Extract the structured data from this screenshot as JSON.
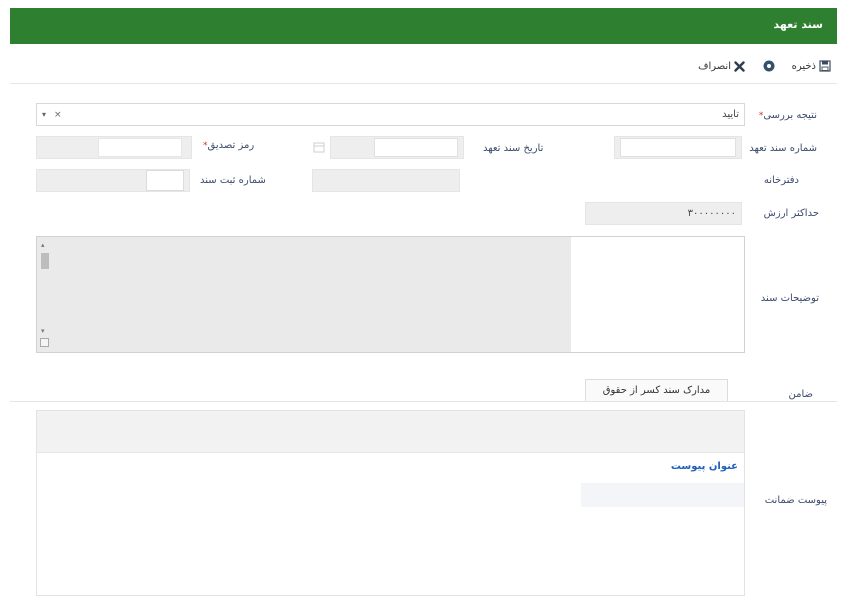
{
  "window": {
    "title": "سند تعهد"
  },
  "toolbar": {
    "save_label": "ذخیره",
    "cancel_label": "انصراف"
  },
  "form": {
    "review_result": {
      "label": "نتیجه بررسی",
      "value": "تایید"
    },
    "commitment_number": {
      "label": "شماره سند تعهد"
    },
    "commitment_date": {
      "label": "تاریخ سند تعهد"
    },
    "confirm_code": {
      "label": "رمز تصدیق"
    },
    "notary_office": {
      "label": "دفترخانه"
    },
    "registration_number": {
      "label": "شماره ثبت سند"
    },
    "max_value": {
      "label": "حداکثر ارزش",
      "value": "۳۰۰۰۰۰۰۰۰"
    },
    "description": {
      "label": "توضیحات سند"
    }
  },
  "guarantor": {
    "label": "ضامن",
    "tab_label": "مدارک سند کسر از حقوق"
  },
  "attachments": {
    "label": "پیوست ضمانت",
    "title_link": "عنوان پیوست"
  },
  "colors": {
    "header_green": "#2f7f31",
    "label_text": "#3a4a6b",
    "link_blue": "#1f5fbf"
  }
}
